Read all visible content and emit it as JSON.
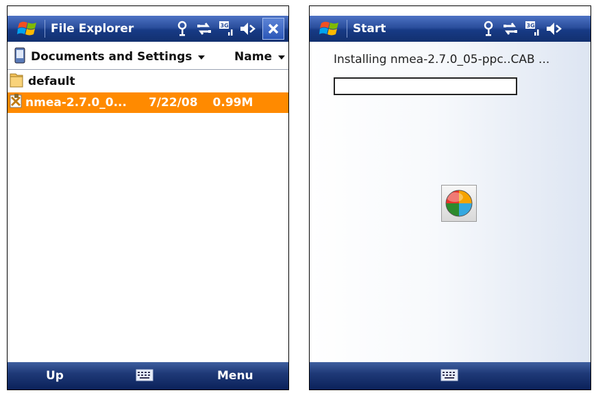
{
  "left_screen": {
    "title": "File Explorer",
    "path_label": "Documents and Settings",
    "sort_label": "Name",
    "folder_name": "default",
    "file": {
      "name": "nmea-2.7.0_0...",
      "date": "7/22/08",
      "size": "0.99M"
    },
    "softkeys": {
      "left": "Up",
      "right": "Menu"
    },
    "status_icons": [
      "antenna-icon",
      "sync-arrows-icon",
      "3g-signal-icon",
      "speaker-muted-icon"
    ],
    "highlight_color": "#ff8a00"
  },
  "right_screen": {
    "title": "Start",
    "install_text": "Installing nmea-2.7.0_05-ppc..CAB ...",
    "progress": 0.0,
    "status_icons": [
      "antenna-icon",
      "sync-arrows-icon",
      "3g-signal-icon",
      "speaker-muted-icon"
    ]
  },
  "colors": {
    "titlebar": "#2b4f9c",
    "softkey_bar": "#1f3a78"
  }
}
